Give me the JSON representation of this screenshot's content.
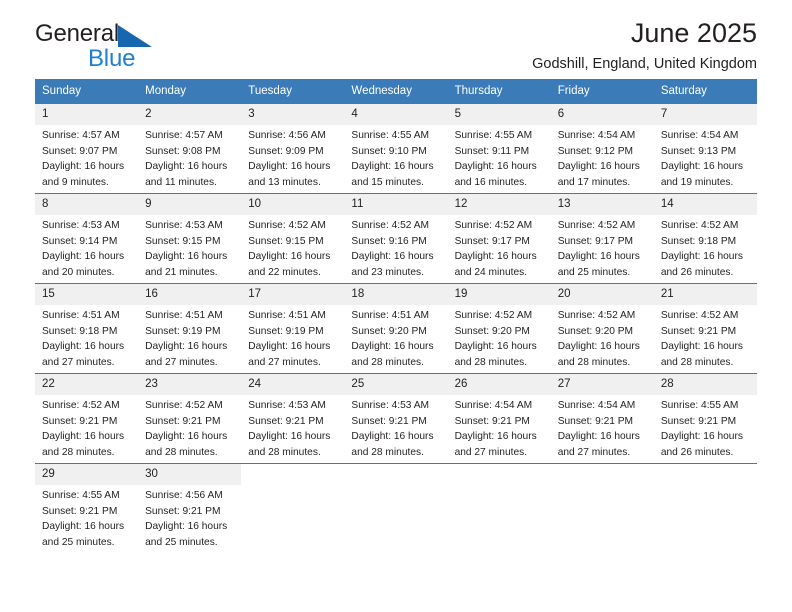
{
  "brand": {
    "name_part1": "General",
    "name_part2": "Blue",
    "triangle_icon": "triangle-logo-icon",
    "accent_color": "#1f7fd4"
  },
  "header": {
    "title": "June 2025",
    "subtitle": "Godshill, England, United Kingdom"
  },
  "theme": {
    "header_row_color": "#3b7cb8",
    "daynum_background": "#f0f0f0",
    "text_color": "#231f20"
  },
  "weekday_headers": [
    "Sunday",
    "Monday",
    "Tuesday",
    "Wednesday",
    "Thursday",
    "Friday",
    "Saturday"
  ],
  "labels": {
    "sunrise_prefix": "Sunrise:",
    "sunset_prefix": "Sunset:",
    "daylight_prefix": "Daylight:"
  },
  "weeks": [
    [
      {
        "day": "1",
        "sunrise": "Sunrise: 4:57 AM",
        "sunset": "Sunset: 9:07 PM",
        "daylight1": "Daylight: 16 hours",
        "daylight2": "and 9 minutes."
      },
      {
        "day": "2",
        "sunrise": "Sunrise: 4:57 AM",
        "sunset": "Sunset: 9:08 PM",
        "daylight1": "Daylight: 16 hours",
        "daylight2": "and 11 minutes."
      },
      {
        "day": "3",
        "sunrise": "Sunrise: 4:56 AM",
        "sunset": "Sunset: 9:09 PM",
        "daylight1": "Daylight: 16 hours",
        "daylight2": "and 13 minutes."
      },
      {
        "day": "4",
        "sunrise": "Sunrise: 4:55 AM",
        "sunset": "Sunset: 9:10 PM",
        "daylight1": "Daylight: 16 hours",
        "daylight2": "and 15 minutes."
      },
      {
        "day": "5",
        "sunrise": "Sunrise: 4:55 AM",
        "sunset": "Sunset: 9:11 PM",
        "daylight1": "Daylight: 16 hours",
        "daylight2": "and 16 minutes."
      },
      {
        "day": "6",
        "sunrise": "Sunrise: 4:54 AM",
        "sunset": "Sunset: 9:12 PM",
        "daylight1": "Daylight: 16 hours",
        "daylight2": "and 17 minutes."
      },
      {
        "day": "7",
        "sunrise": "Sunrise: 4:54 AM",
        "sunset": "Sunset: 9:13 PM",
        "daylight1": "Daylight: 16 hours",
        "daylight2": "and 19 minutes."
      }
    ],
    [
      {
        "day": "8",
        "sunrise": "Sunrise: 4:53 AM",
        "sunset": "Sunset: 9:14 PM",
        "daylight1": "Daylight: 16 hours",
        "daylight2": "and 20 minutes."
      },
      {
        "day": "9",
        "sunrise": "Sunrise: 4:53 AM",
        "sunset": "Sunset: 9:15 PM",
        "daylight1": "Daylight: 16 hours",
        "daylight2": "and 21 minutes."
      },
      {
        "day": "10",
        "sunrise": "Sunrise: 4:52 AM",
        "sunset": "Sunset: 9:15 PM",
        "daylight1": "Daylight: 16 hours",
        "daylight2": "and 22 minutes."
      },
      {
        "day": "11",
        "sunrise": "Sunrise: 4:52 AM",
        "sunset": "Sunset: 9:16 PM",
        "daylight1": "Daylight: 16 hours",
        "daylight2": "and 23 minutes."
      },
      {
        "day": "12",
        "sunrise": "Sunrise: 4:52 AM",
        "sunset": "Sunset: 9:17 PM",
        "daylight1": "Daylight: 16 hours",
        "daylight2": "and 24 minutes."
      },
      {
        "day": "13",
        "sunrise": "Sunrise: 4:52 AM",
        "sunset": "Sunset: 9:17 PM",
        "daylight1": "Daylight: 16 hours",
        "daylight2": "and 25 minutes."
      },
      {
        "day": "14",
        "sunrise": "Sunrise: 4:52 AM",
        "sunset": "Sunset: 9:18 PM",
        "daylight1": "Daylight: 16 hours",
        "daylight2": "and 26 minutes."
      }
    ],
    [
      {
        "day": "15",
        "sunrise": "Sunrise: 4:51 AM",
        "sunset": "Sunset: 9:18 PM",
        "daylight1": "Daylight: 16 hours",
        "daylight2": "and 27 minutes."
      },
      {
        "day": "16",
        "sunrise": "Sunrise: 4:51 AM",
        "sunset": "Sunset: 9:19 PM",
        "daylight1": "Daylight: 16 hours",
        "daylight2": "and 27 minutes."
      },
      {
        "day": "17",
        "sunrise": "Sunrise: 4:51 AM",
        "sunset": "Sunset: 9:19 PM",
        "daylight1": "Daylight: 16 hours",
        "daylight2": "and 27 minutes."
      },
      {
        "day": "18",
        "sunrise": "Sunrise: 4:51 AM",
        "sunset": "Sunset: 9:20 PM",
        "daylight1": "Daylight: 16 hours",
        "daylight2": "and 28 minutes."
      },
      {
        "day": "19",
        "sunrise": "Sunrise: 4:52 AM",
        "sunset": "Sunset: 9:20 PM",
        "daylight1": "Daylight: 16 hours",
        "daylight2": "and 28 minutes."
      },
      {
        "day": "20",
        "sunrise": "Sunrise: 4:52 AM",
        "sunset": "Sunset: 9:20 PM",
        "daylight1": "Daylight: 16 hours",
        "daylight2": "and 28 minutes."
      },
      {
        "day": "21",
        "sunrise": "Sunrise: 4:52 AM",
        "sunset": "Sunset: 9:21 PM",
        "daylight1": "Daylight: 16 hours",
        "daylight2": "and 28 minutes."
      }
    ],
    [
      {
        "day": "22",
        "sunrise": "Sunrise: 4:52 AM",
        "sunset": "Sunset: 9:21 PM",
        "daylight1": "Daylight: 16 hours",
        "daylight2": "and 28 minutes."
      },
      {
        "day": "23",
        "sunrise": "Sunrise: 4:52 AM",
        "sunset": "Sunset: 9:21 PM",
        "daylight1": "Daylight: 16 hours",
        "daylight2": "and 28 minutes."
      },
      {
        "day": "24",
        "sunrise": "Sunrise: 4:53 AM",
        "sunset": "Sunset: 9:21 PM",
        "daylight1": "Daylight: 16 hours",
        "daylight2": "and 28 minutes."
      },
      {
        "day": "25",
        "sunrise": "Sunrise: 4:53 AM",
        "sunset": "Sunset: 9:21 PM",
        "daylight1": "Daylight: 16 hours",
        "daylight2": "and 28 minutes."
      },
      {
        "day": "26",
        "sunrise": "Sunrise: 4:54 AM",
        "sunset": "Sunset: 9:21 PM",
        "daylight1": "Daylight: 16 hours",
        "daylight2": "and 27 minutes."
      },
      {
        "day": "27",
        "sunrise": "Sunrise: 4:54 AM",
        "sunset": "Sunset: 9:21 PM",
        "daylight1": "Daylight: 16 hours",
        "daylight2": "and 27 minutes."
      },
      {
        "day": "28",
        "sunrise": "Sunrise: 4:55 AM",
        "sunset": "Sunset: 9:21 PM",
        "daylight1": "Daylight: 16 hours",
        "daylight2": "and 26 minutes."
      }
    ],
    [
      {
        "day": "29",
        "sunrise": "Sunrise: 4:55 AM",
        "sunset": "Sunset: 9:21 PM",
        "daylight1": "Daylight: 16 hours",
        "daylight2": "and 25 minutes."
      },
      {
        "day": "30",
        "sunrise": "Sunrise: 4:56 AM",
        "sunset": "Sunset: 9:21 PM",
        "daylight1": "Daylight: 16 hours",
        "daylight2": "and 25 minutes."
      },
      {
        "day": "",
        "sunrise": "",
        "sunset": "",
        "daylight1": "",
        "daylight2": ""
      },
      {
        "day": "",
        "sunrise": "",
        "sunset": "",
        "daylight1": "",
        "daylight2": ""
      },
      {
        "day": "",
        "sunrise": "",
        "sunset": "",
        "daylight1": "",
        "daylight2": ""
      },
      {
        "day": "",
        "sunrise": "",
        "sunset": "",
        "daylight1": "",
        "daylight2": ""
      },
      {
        "day": "",
        "sunrise": "",
        "sunset": "",
        "daylight1": "",
        "daylight2": ""
      }
    ]
  ]
}
